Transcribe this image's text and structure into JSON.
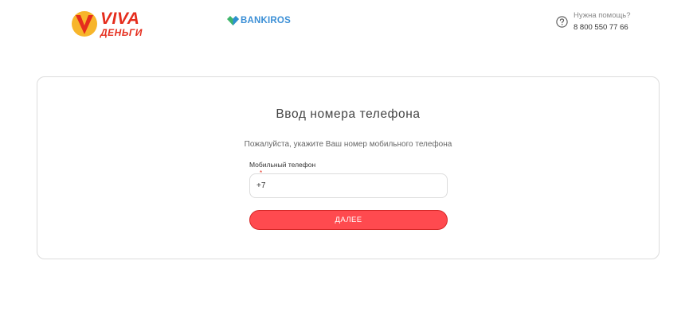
{
  "header": {
    "logo_word": "VIVA",
    "logo_sub": "ДЕНЬГИ",
    "partner_word": "BANKIROS",
    "help_label": "Нужна помощь?",
    "help_phone": "8 800 550 77 66"
  },
  "form": {
    "title": "Ввод номера телефона",
    "subtitle": "Пожалуйста, укажите Ваш номер мобильного телефона",
    "phone_label": "Мобильный телефон",
    "required_mark": "*",
    "phone_value": "+7",
    "submit_label": "ДАЛЕЕ"
  },
  "colors": {
    "brand_red": "#e52d1d",
    "button_red": "#ff4a4f",
    "partner_blue": "#3b8fd6",
    "partner_green": "#3fb56b"
  },
  "icons": {
    "viva_mark": "viva-v-mark-icon",
    "partner_mark": "bankiros-mark-icon",
    "help": "question-circle-icon"
  }
}
